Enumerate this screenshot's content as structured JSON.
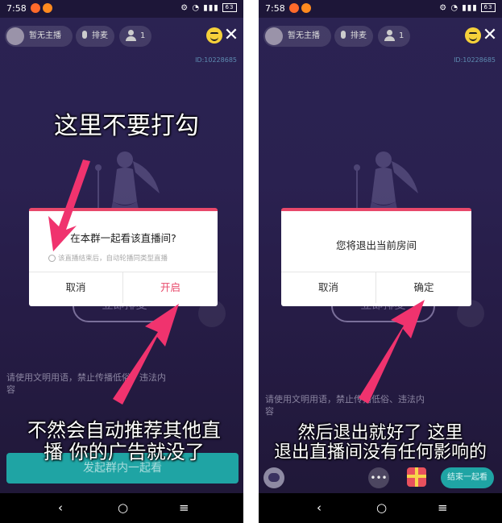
{
  "status_bar": {
    "time": "7:58",
    "battery": "63"
  },
  "top_bar": {
    "host_label": "暂无主播",
    "mic_label": "排麦",
    "audience_count": "1",
    "room_id": "ID:10228685"
  },
  "stage": {
    "queue_button": "立即排麦",
    "notice_text": "请使用文明用语，禁止传播低俗、违法内容"
  },
  "bottom": {
    "group_watch_button": "发起群内一起看",
    "more_label": "•••",
    "end_together_button": "结束一起看"
  },
  "nav": {
    "back": "‹",
    "home": "○",
    "menu": "≡"
  },
  "dialog_left": {
    "title": "在本群一起看该直播间?",
    "option_label": "该直播结束后，自动轮播同类型直播",
    "cancel": "取消",
    "confirm": "开启"
  },
  "dialog_right": {
    "title": "您将退出当前房间",
    "cancel": "取消",
    "confirm": "确定"
  },
  "annotations": {
    "left_top": "这里不要打勾",
    "left_bottom_line1": "不然会自动推荐其他直",
    "left_bottom_line2": "播 你的广告就没了",
    "right_bottom_line1": "然后退出就好了 这里",
    "right_bottom_line2": "退出直播间没有任何影响的"
  },
  "colors": {
    "accent": "#e8486a",
    "arrow": "#f0336e",
    "teal": "#1fa4a4"
  }
}
